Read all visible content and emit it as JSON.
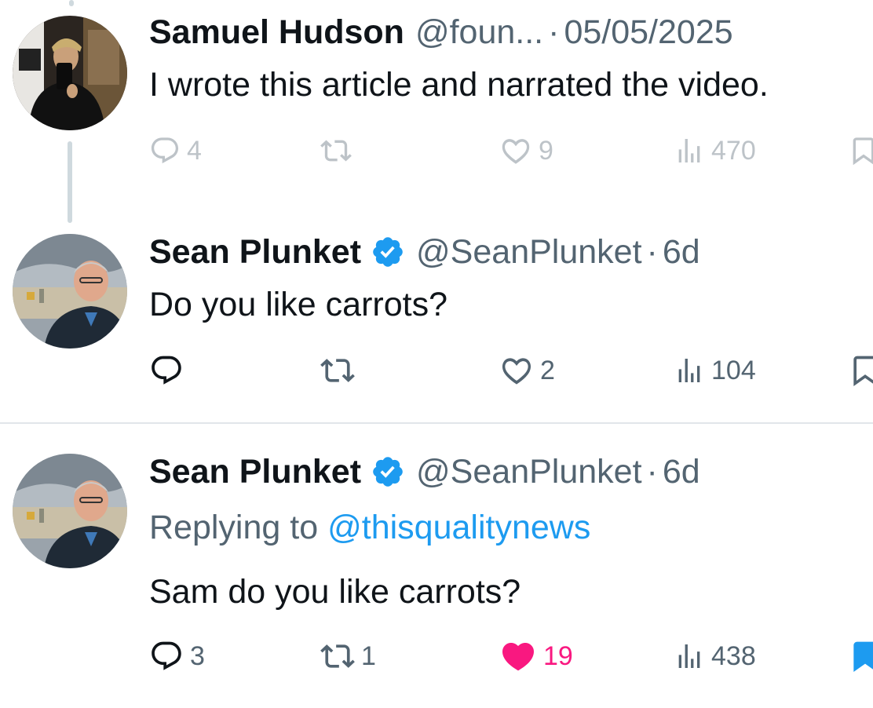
{
  "tweets": [
    {
      "name": "Samuel Hudson",
      "handle": "@foun...",
      "separator": "·",
      "time": "05/05/2025",
      "verified": false,
      "text": "I wrote this article and narrated the video.",
      "stats": {
        "replies": "4",
        "retweets": "",
        "likes": "9",
        "views": "470"
      }
    },
    {
      "name": "Sean Plunket",
      "handle": "@SeanPlunket",
      "separator": "·",
      "time": "6d",
      "verified": true,
      "text": "Do you like carrots?",
      "stats": {
        "replies": "",
        "retweets": "",
        "likes": "2",
        "views": "104"
      }
    },
    {
      "name": "Sean Plunket",
      "handle": "@SeanPlunket",
      "separator": "·",
      "time": "6d",
      "verified": true,
      "replying_prefix": "Replying to",
      "replying_to": "@thisqualitynews",
      "text": "Sam do you like carrots?",
      "stats": {
        "replies": "3",
        "retweets": "1",
        "likes": "19",
        "views": "438"
      },
      "liked": true,
      "bookmarked": true
    }
  ],
  "colors": {
    "text": "#0f1419",
    "muted": "#536471",
    "link": "#1d9bf0",
    "like": "#f91880",
    "verified": "#1d9bf0",
    "thread_line": "#cfd9de"
  }
}
